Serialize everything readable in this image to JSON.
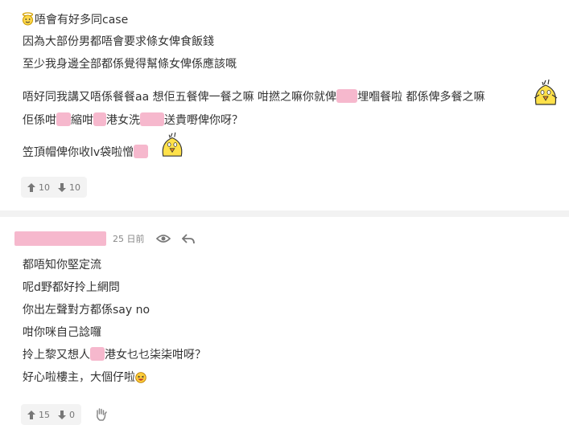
{
  "post1": {
    "lines": [
      "唔會有好多同case",
      "因為大部份男都唔會要求條女俾食飯錢",
      "至少我身邊全部都係覺得幫條女俾係應該嘅",
      "唔好同我講又唔係餐餐aa 想佢五餐俾一餐之嘛 咁撚之嘛你就俾",
      "埋嗰餐啦 都係俾多餐之嘛",
      "佢係咁",
      "縮咁",
      "港女洗",
      "送貴嘢俾你呀？",
      "笠頂帽俾你收lv袋啦憎"
    ],
    "votes": {
      "up": "10",
      "down": "10"
    }
  },
  "post2": {
    "time": "25 日前",
    "lines": [
      "都唔知你堅定流",
      "呢d野都好拎上網問",
      "你出左聲對方都係say no",
      "咁你咪自己諗囉",
      "拎上黎又想人",
      "港女乜乜柒柒咁呀？",
      "好心啦樓主，大個仔啦"
    ],
    "votes": {
      "up": "15",
      "down": "0"
    }
  },
  "icons": {
    "halo": "angel-face-icon",
    "chick": "yellow-chick-sticker-icon",
    "laugh": "laughing-face-icon",
    "eye": "eye-icon",
    "reply": "reply-arrow-icon",
    "up": "thumb-up-arrow-icon",
    "down": "thumb-down-arrow-icon",
    "hand": "wave-hand-icon"
  },
  "colors": {
    "censor": "#f6b8cd",
    "divider": "#f2f2f2",
    "text": "#333333",
    "muted": "#888888"
  }
}
